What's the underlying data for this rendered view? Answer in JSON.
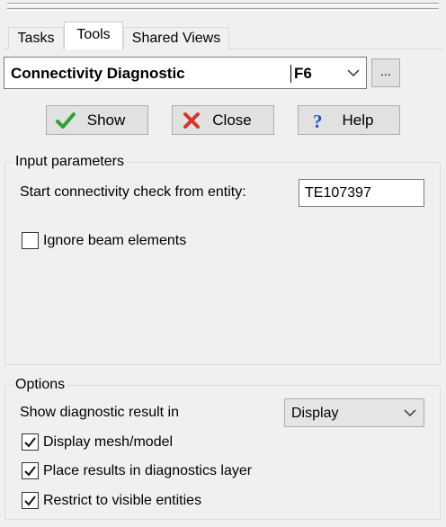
{
  "tabs": [
    {
      "label": "Tasks",
      "active": false
    },
    {
      "label": "Tools",
      "active": true
    },
    {
      "label": "Shared Views",
      "active": false
    }
  ],
  "tool_selector": {
    "value": "Connectivity Diagnostic",
    "shortcut": "F6",
    "browse_label": "..."
  },
  "actions": {
    "show_label": "Show",
    "close_label": "Close",
    "help_label": "Help"
  },
  "input_parameters": {
    "title": "Input parameters",
    "start_entity_label": "Start connectivity check from entity:",
    "start_entity_value": "TE107397",
    "ignore_beam_label": "Ignore beam elements",
    "ignore_beam_checked": false
  },
  "options": {
    "title": "Options",
    "show_result_label": "Show diagnostic result in",
    "show_result_value": "Display",
    "display_mesh_label": "Display mesh/model",
    "display_mesh_checked": true,
    "place_results_label": "Place results in diagnostics layer",
    "place_results_checked": true,
    "restrict_visible_label": "Restrict to visible entities",
    "restrict_visible_checked": true
  },
  "colors": {
    "show_icon": "#2ea02e",
    "close_icon": "#d9342b",
    "help_icon": "#1f4fd1"
  }
}
